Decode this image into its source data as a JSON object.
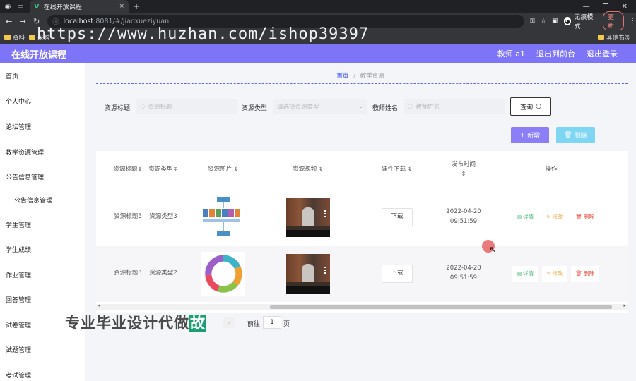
{
  "browser": {
    "tab_title": "在线开放课程",
    "tab_close": "×",
    "new_tab": "+",
    "window_controls": [
      "—",
      "❐",
      "✕"
    ],
    "nav": [
      "←",
      "→",
      "↻"
    ],
    "url_host": "localhost",
    "url_path": ":8081/#/jiaoxueziyuan",
    "incognito_label": "无痕模式",
    "update_label": "更新",
    "bookmarks": [
      "资料",
      "采购"
    ],
    "bookmarks_right": "其他书签",
    "overlay_url": "https://www.huzhan.com/ishop39397"
  },
  "header": {
    "title": "在线开放课程",
    "user": "教师 a1",
    "back_front": "退出到前台",
    "logout": "退出登录"
  },
  "sidebar": {
    "items": [
      "首页",
      "个人中心",
      "论坛管理",
      "教学资源管理",
      "公告信息管理",
      "公告信息管理",
      "学生管理",
      "学生成绩",
      "作业管理",
      "回答管理",
      "试卷管理",
      "试题管理",
      "考试管理"
    ]
  },
  "breadcrumb": {
    "home": "首页",
    "sep": "/",
    "current": "教学资源"
  },
  "search": {
    "title_label": "资源标题",
    "title_placeholder": "资源标题",
    "type_label": "资源类型",
    "type_placeholder": "请选择资源类型",
    "teacher_label": "教师姓名",
    "teacher_placeholder": "教师姓名",
    "query_button": "查询"
  },
  "actions": {
    "add": "新增",
    "delete": "删除"
  },
  "table": {
    "headers": [
      "资源标题",
      "资源类型",
      "资源图片",
      "资源视频",
      "课件下载",
      "发布时间",
      "操作"
    ],
    "rows": [
      {
        "title": "资源标题5",
        "type": "资源类型3",
        "download": "下载",
        "time": "2022-04-20 09:51:59",
        "detail": "详情",
        "edit": "修改",
        "remove": "删除"
      },
      {
        "title": "资源标题3",
        "type": "资源类型2",
        "download": "下载",
        "time": "2022-04-20 09:51:59",
        "detail": "详情",
        "edit": "修改",
        "remove": "删除"
      }
    ]
  },
  "pagination": {
    "goto": "前往",
    "page": "1",
    "unit": "页"
  },
  "overlay_text": {
    "main": "专业毕业设计代做",
    "tail": "故"
  },
  "colors": {
    "header": "#7e74f7",
    "accent": "#5b6cf0",
    "add_button": "#8c7ef7",
    "delete_button": "#7fd6f2"
  }
}
